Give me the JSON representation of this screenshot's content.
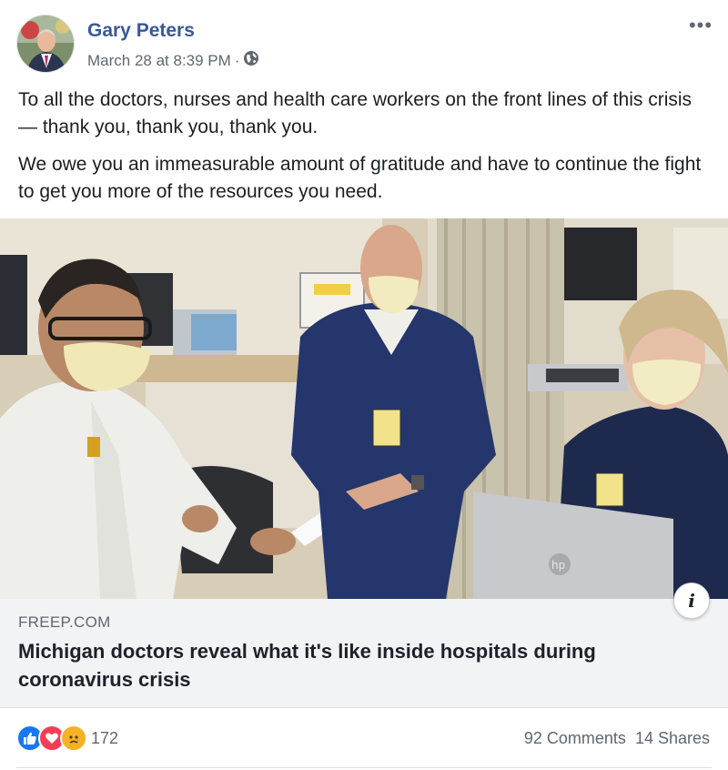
{
  "post": {
    "author": "Gary Peters",
    "timestamp": "March 28 at 8:39 PM",
    "separator": "·",
    "privacy_icon": "globe-icon",
    "more_icon": "•••",
    "paragraphs": [
      "To all the doctors, nurses and health care workers on the front lines of this crisis — thank you, thank you, thank you.",
      "We owe you an immeasurable amount of gratitude and have to continue the fight to get you more of the resources you need."
    ]
  },
  "photo": {
    "info_icon": "i",
    "badge_letter": "hp"
  },
  "link_preview": {
    "domain": "FREEP.COM",
    "headline": "Michigan doctors reveal what it's like inside hospitals during coronavirus crisis"
  },
  "footer": {
    "reaction_icons": [
      "like-icon",
      "love-icon",
      "sad-icon"
    ],
    "reaction_count": "172",
    "comments": "92 Comments",
    "shares": "14 Shares"
  },
  "colors": {
    "author_link": "#385898",
    "muted_text": "#606770",
    "like_blue": "#1877f2",
    "love_red": "#f33e58",
    "sad_yellow": "#f7b125",
    "link_box_bg": "#f2f3f5"
  }
}
